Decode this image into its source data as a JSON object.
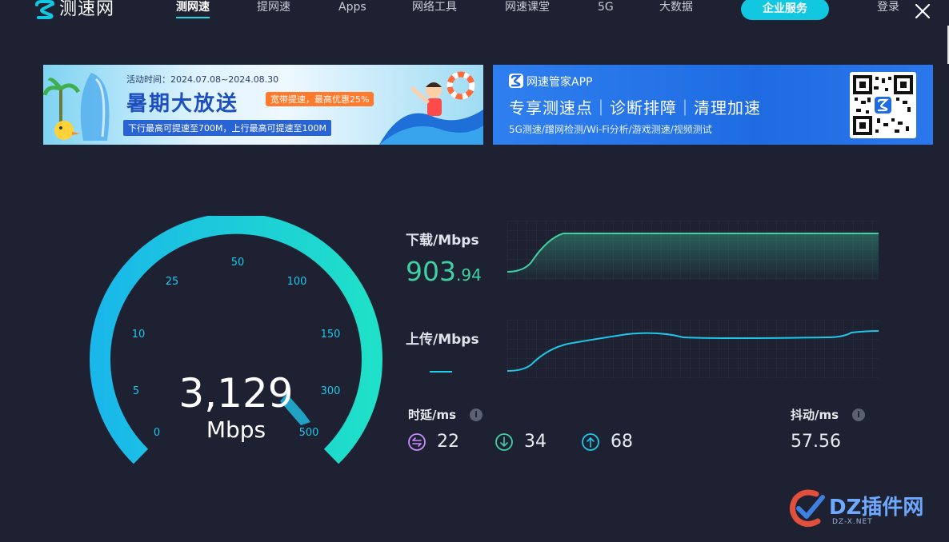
{
  "app": {
    "logo_text": "测速网"
  },
  "nav": {
    "items": [
      "测网速",
      "提网速",
      "Apps",
      "网络工具",
      "网速课堂",
      "5G",
      "大数据"
    ],
    "enterprise_label": "企业服务",
    "login_label": "登录"
  },
  "banner_left": {
    "date": "活动时间：2024.07.08~2024.08.30",
    "title": "暑期大放送",
    "badge": "宽带提速，最高优惠25%",
    "subtitle": "下行最高可提速至700M，上行最高可提速至100M"
  },
  "banner_right": {
    "app_name": "网速管家APP",
    "features": "专享测速点｜诊断排障｜清理加速",
    "subtitle": "5G测速/蹭网检测/Wi-Fi分析/游戏测速/视频测试"
  },
  "gauge": {
    "ticks": [
      "0",
      "5",
      "10",
      "25",
      "50",
      "100",
      "150",
      "300",
      "500"
    ],
    "speed": "3,129",
    "unit": "Mbps"
  },
  "download": {
    "label": "下载/Mbps",
    "value_int": "903",
    "value_dec": ".94"
  },
  "upload": {
    "label": "上传/Mbps"
  },
  "latency": {
    "label": "时延/ms",
    "ping": "22",
    "down": "34",
    "up": "68"
  },
  "jitter": {
    "label": "抖动/ms",
    "value": "57.56"
  },
  "watermark": {
    "text": "DZ插件网",
    "sub": "DZ-X.NET"
  },
  "colors": {
    "background": "#1d2131",
    "accent_cyan": "#12c7e0",
    "download_green": "#3fd0a4",
    "ping_purple": "#c98bff"
  }
}
